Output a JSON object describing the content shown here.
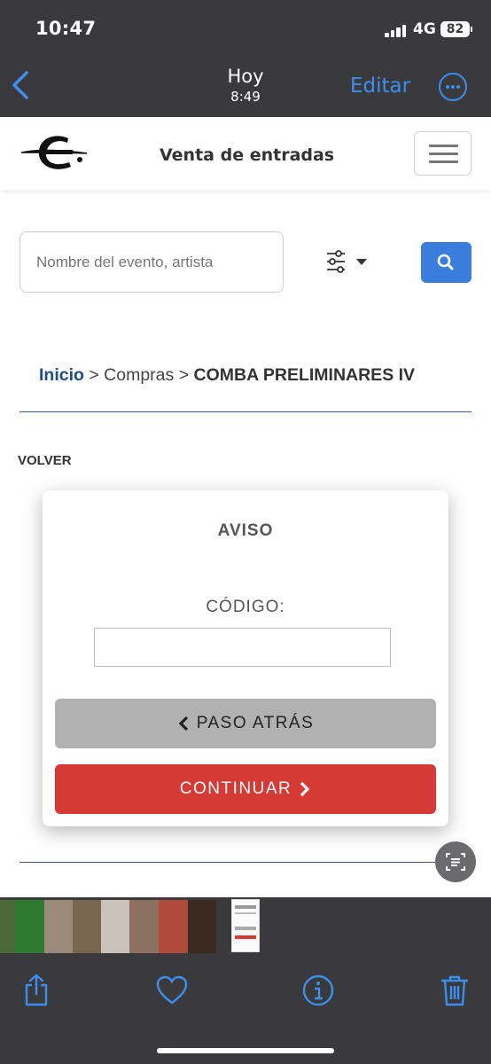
{
  "status_bar": {
    "time": "10:47",
    "network": "4G",
    "battery": "82"
  },
  "viewer_nav": {
    "title": "Hoy",
    "subtitle": "8:49",
    "edit_label": "Editar",
    "accent_color": "#3b8ff0"
  },
  "site": {
    "title": "Venta de entradas"
  },
  "search": {
    "placeholder": "Nombre del evento, artista",
    "button_color": "#3b7ddd"
  },
  "breadcrumb": {
    "home": "Inicio",
    "separator": ">",
    "section": "Compras",
    "current": "COMBA PRELIMINARES IV"
  },
  "back_link": "VOLVER",
  "modal": {
    "title": "AVISO",
    "code_label": "CÓDIGO:",
    "code_value": "",
    "back_button": "PASO ATRÁS",
    "continue_button": "CONTINUAR",
    "continue_color": "#d63a35",
    "back_color": "#b1b1b1"
  },
  "toolbar": {
    "icons": [
      "share-icon",
      "heart-icon",
      "info-icon",
      "trash-icon"
    ]
  }
}
